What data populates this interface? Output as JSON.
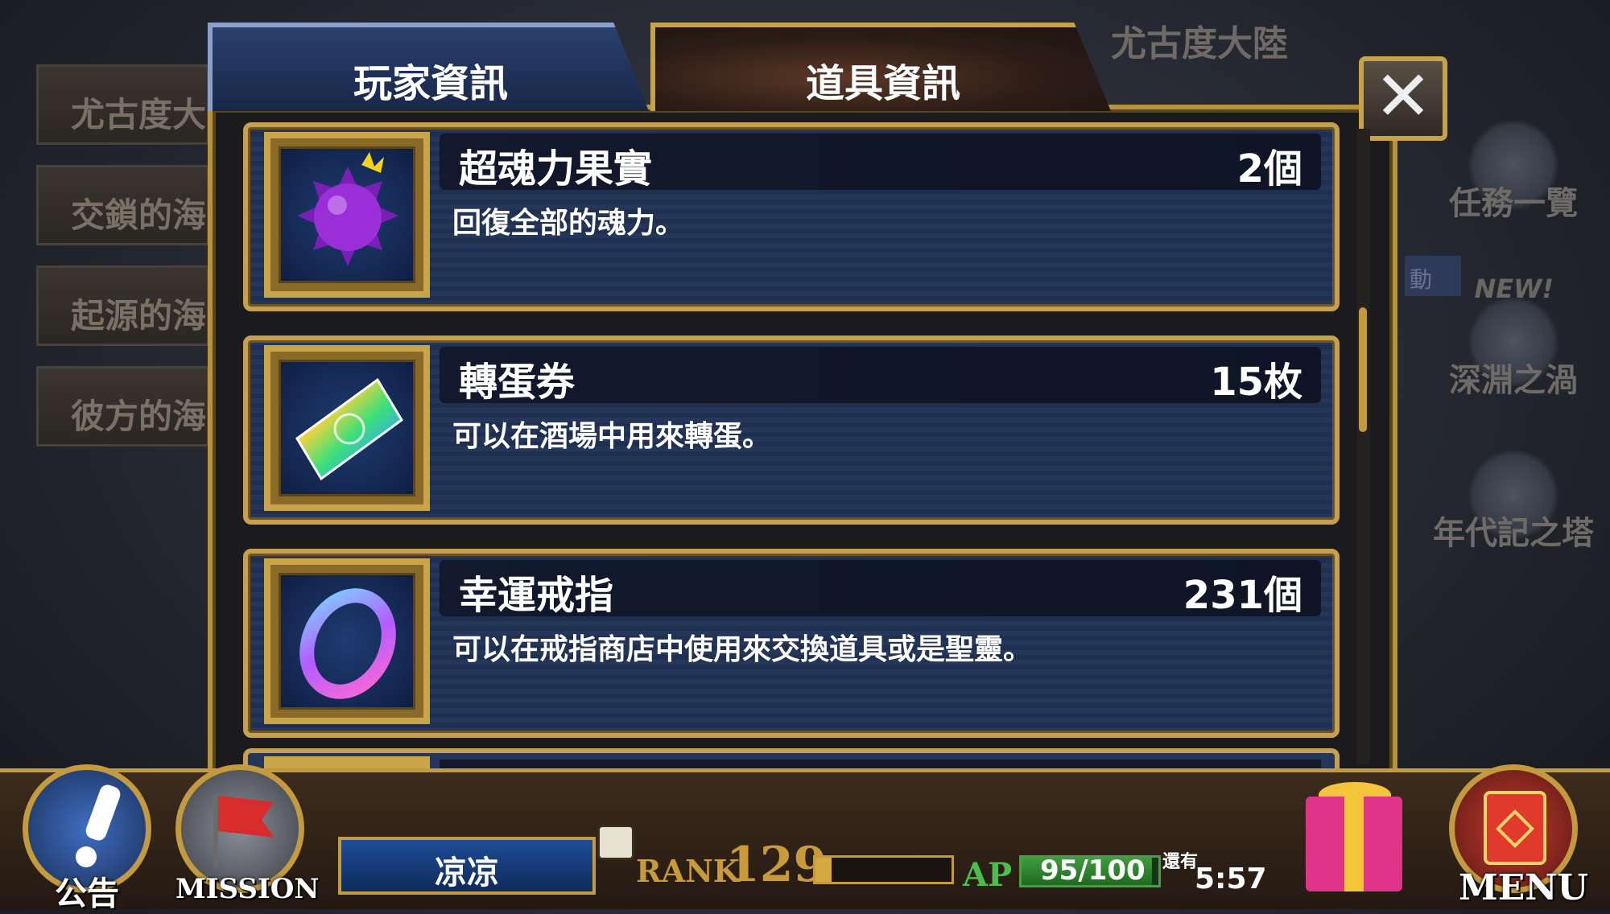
{
  "background": {
    "region_title": "尤古度大陸",
    "left_menu": [
      "尤古度大",
      "交鎖的海",
      "起源的海",
      "彼方的海"
    ],
    "right_menu": [
      "任務一覽",
      "深淵之渦",
      "年代記之塔"
    ],
    "new_badge": "NEW!",
    "event_badge": "動"
  },
  "modal": {
    "tabs": [
      {
        "label": "玩家資訊",
        "active": false
      },
      {
        "label": "道具資訊",
        "active": true
      }
    ],
    "close_icon": "close-icon",
    "items": [
      {
        "name": "超魂力果實",
        "count": "2個",
        "desc": "回復全部的魂力。",
        "icon": "purple-fruit-icon"
      },
      {
        "name": "轉蛋券",
        "count": "15枚",
        "desc": "可以在酒場中用來轉蛋。",
        "icon": "rainbow-ticket-icon"
      },
      {
        "name": "幸運戒指",
        "count": "231個",
        "desc": "可以在戒指商店中使用來交換道具或是聖靈。",
        "icon": "luck-ring-icon"
      }
    ],
    "scroll_position": 0.3
  },
  "hud": {
    "notice_label": "公告",
    "mission_label": "MISSION",
    "menu_label": "MENU",
    "player_name": "凉凉",
    "rank_label": "RANK",
    "rank_value": "129",
    "rank_progress": 0.12,
    "ap_label": "AP",
    "ap_value": "95/100",
    "ap_progress": 0.95,
    "ap_remaining_label": "還有",
    "ap_remaining_time": "5:57"
  },
  "colors": {
    "gold": "#c49a3e",
    "card_blue": "#243659",
    "ap_green": "#4bbf4b"
  }
}
